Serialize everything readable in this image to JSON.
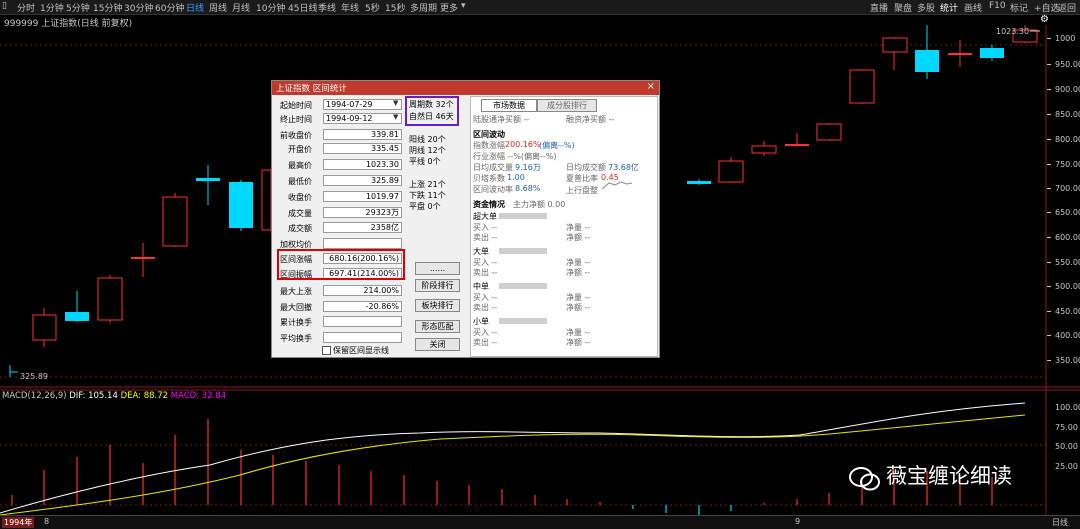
{
  "toolbar": {
    "left_items": [
      "分时",
      "1分钟",
      "5分钟",
      "15分钟",
      "30分钟",
      "60分钟",
      "日线",
      "周线",
      "月线",
      "10分钟",
      "45日线",
      "季线",
      "年线",
      "5秒",
      "15秒",
      "多周期",
      "更多"
    ],
    "active_item": "日线",
    "right_items": [
      "直播",
      "聚盘",
      "多股",
      "统计",
      "画线",
      "F10",
      "标记",
      "+自选",
      "返回"
    ],
    "active_right": "统计"
  },
  "chart_title": "999999 上证指数(日线 前复权)",
  "price_axis": [
    "1000",
    "950.00",
    "900.00",
    "850.00",
    "800.00",
    "750.00",
    "700.00",
    "650.00",
    "600.00",
    "550.00",
    "500.00",
    "450.00",
    "400.00",
    "350.00"
  ],
  "high_label": "1023.30",
  "low_label": "325.89",
  "macd_legend": {
    "name": "MACD(12,26,9)",
    "dif_label": "DIF: 105.14",
    "dea_label": "DEA: 88.72",
    "macd_label": "MACD: 32.84",
    "dif_color": "#ffffff",
    "dea_color": "#ffff00",
    "macd_color": "#ff00ff"
  },
  "macd_axis": [
    "100.00",
    "75.00",
    "50.00",
    "25.00"
  ],
  "bottom_bar": {
    "year": "1994年",
    "m1": "8",
    "m2": "9",
    "right": "日线"
  },
  "dialog": {
    "title": "上证指数 区间统计",
    "close": "×",
    "start_label": "起始时间",
    "start_value": "1994-07-29",
    "end_label": "终止时间",
    "end_value": "1994-09-12",
    "period_count": "周期数 32个",
    "natural_days": "自然日 46天",
    "rows": [
      {
        "label": "前收盘价",
        "value": "339.81"
      },
      {
        "label": "开盘价",
        "value": "335.45"
      },
      {
        "label": "最高价",
        "value": "1023.30"
      },
      {
        "label": "最低价",
        "value": "325.89"
      },
      {
        "label": "收盘价",
        "value": "1019.97"
      },
      {
        "label": "成交量",
        "value": "29323万"
      },
      {
        "label": "成交额",
        "value": "2358亿"
      },
      {
        "label": "加权均价",
        "value": ""
      },
      {
        "label": "区间涨幅",
        "value": "680.16(200.16%)"
      },
      {
        "label": "区间振幅",
        "value": "697.41(214.00%)"
      },
      {
        "label": "最大上涨",
        "value": "214.00%"
      },
      {
        "label": "最大回撤",
        "value": "-20.86%"
      },
      {
        "label": "累计换手",
        "value": ""
      },
      {
        "label": "平均换手",
        "value": ""
      }
    ],
    "stats_up_line": "阳线 20个",
    "stats_down_line": "阴线 12个",
    "stats_flat_line": "平线 0个",
    "stats_rise": "上涨 21个",
    "stats_fall": "下跌 11个",
    "stats_flat": "平盘 0个",
    "btn_dots": "......",
    "btn_stage": "阶段排行",
    "btn_sector": "板块排行",
    "btn_pattern": "形态匹配",
    "btn_close": "关闭",
    "checkbox_label": "保留区间显示线",
    "tab_market": "市场数据",
    "tab_component": "成分股排行",
    "lugang": "陆股通净买额 --",
    "rongzi": "融资净买额 --",
    "section_volatility": "区间波动",
    "idx_change_label": "指数涨幅",
    "idx_change_value": "200.16%",
    "idx_change_dev": "(偏离--%)",
    "ind_change": "行业涨幅 --%(偏离--%)",
    "avg_volume_label": "日均成交量",
    "avg_volume_value": "9.16万",
    "avg_amount_label": "日均成交额",
    "avg_amount_value": "73.68亿",
    "beta_label": "贝塔系数",
    "beta_value": "1.00",
    "sharpe_label": "夏普比率",
    "sharpe_value": "0.45",
    "vol_rate_label": "区间波动率",
    "vol_rate_value": "8.68%",
    "trend_label": "上行盘整",
    "section_funds": "资金情况",
    "main_net": "主力净额 0.00",
    "groups": [
      {
        "name": "超大单",
        "buy": "买入 --",
        "sell": "卖出 --",
        "net": "净量 --",
        "net_amt": "净额 --"
      },
      {
        "name": "大单",
        "buy": "买入 --",
        "sell": "卖出 --",
        "net": "净量 --",
        "net_amt": "净额 --"
      },
      {
        "name": "中单",
        "buy": "买入 --",
        "sell": "卖出 --",
        "net": "净量 --",
        "net_amt": "净额 --"
      },
      {
        "name": "小单",
        "buy": "买入 --",
        "sell": "卖出 --",
        "net": "净量 --",
        "net_amt": "净额 --"
      }
    ]
  },
  "watermark": "薇宝缠论细读"
}
